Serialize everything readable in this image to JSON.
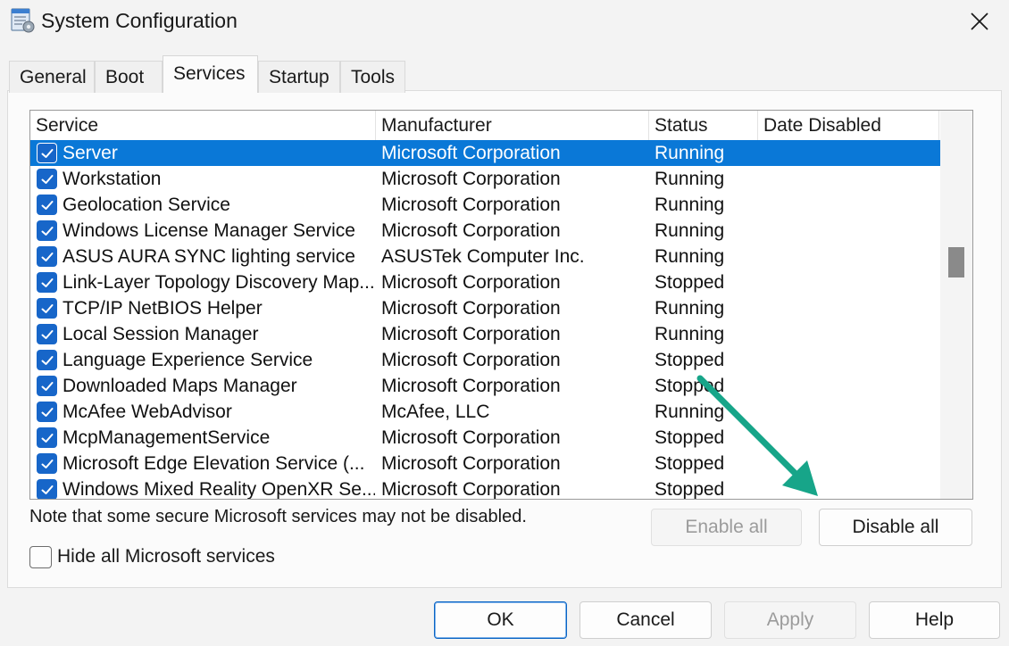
{
  "window": {
    "title": "System Configuration",
    "icon": "msconfig-icon",
    "close_icon": "close-icon"
  },
  "tabs": [
    {
      "label": "General",
      "active": false
    },
    {
      "label": "Boot",
      "active": false
    },
    {
      "label": "Services",
      "active": true
    },
    {
      "label": "Startup",
      "active": false
    },
    {
      "label": "Tools",
      "active": false
    }
  ],
  "services": {
    "columns": [
      "Service",
      "Manufacturer",
      "Status",
      "Date Disabled"
    ],
    "rows": [
      {
        "checked": true,
        "service": "Server",
        "manufacturer": "Microsoft Corporation",
        "status": "Running",
        "date_disabled": "",
        "selected": true
      },
      {
        "checked": true,
        "service": "Workstation",
        "manufacturer": "Microsoft Corporation",
        "status": "Running",
        "date_disabled": ""
      },
      {
        "checked": true,
        "service": "Geolocation Service",
        "manufacturer": "Microsoft Corporation",
        "status": "Running",
        "date_disabled": ""
      },
      {
        "checked": true,
        "service": "Windows License Manager Service",
        "manufacturer": "Microsoft Corporation",
        "status": "Running",
        "date_disabled": ""
      },
      {
        "checked": true,
        "service": "ASUS AURA SYNC lighting service",
        "manufacturer": "ASUSTek Computer Inc.",
        "status": "Running",
        "date_disabled": ""
      },
      {
        "checked": true,
        "service": "Link-Layer Topology Discovery Map...",
        "manufacturer": "Microsoft Corporation",
        "status": "Stopped",
        "date_disabled": ""
      },
      {
        "checked": true,
        "service": "TCP/IP NetBIOS Helper",
        "manufacturer": "Microsoft Corporation",
        "status": "Running",
        "date_disabled": ""
      },
      {
        "checked": true,
        "service": "Local Session Manager",
        "manufacturer": "Microsoft Corporation",
        "status": "Running",
        "date_disabled": ""
      },
      {
        "checked": true,
        "service": "Language Experience Service",
        "manufacturer": "Microsoft Corporation",
        "status": "Stopped",
        "date_disabled": ""
      },
      {
        "checked": true,
        "service": "Downloaded Maps Manager",
        "manufacturer": "Microsoft Corporation",
        "status": "Stopped",
        "date_disabled": ""
      },
      {
        "checked": true,
        "service": "McAfee WebAdvisor",
        "manufacturer": "McAfee, LLC",
        "status": "Running",
        "date_disabled": ""
      },
      {
        "checked": true,
        "service": "McpManagementService",
        "manufacturer": "Microsoft Corporation",
        "status": "Stopped",
        "date_disabled": ""
      },
      {
        "checked": true,
        "service": "Microsoft Edge Elevation Service (...",
        "manufacturer": "Microsoft Corporation",
        "status": "Stopped",
        "date_disabled": ""
      },
      {
        "checked": true,
        "service": "Windows Mixed Reality OpenXR Se...",
        "manufacturer": "Microsoft Corporation",
        "status": "Stopped",
        "date_disabled": ""
      }
    ]
  },
  "note": "Note that some secure Microsoft services may not be disabled.",
  "buttons": {
    "enable_all": "Enable all",
    "disable_all": "Disable all",
    "ok": "OK",
    "cancel": "Cancel",
    "apply": "Apply",
    "help": "Help"
  },
  "hide_ms": {
    "label": "Hide all Microsoft services",
    "checked": false
  },
  "colors": {
    "selection": "#0a78d7",
    "checkbox": "#1766c9",
    "annotation_arrow": "#17a589"
  }
}
